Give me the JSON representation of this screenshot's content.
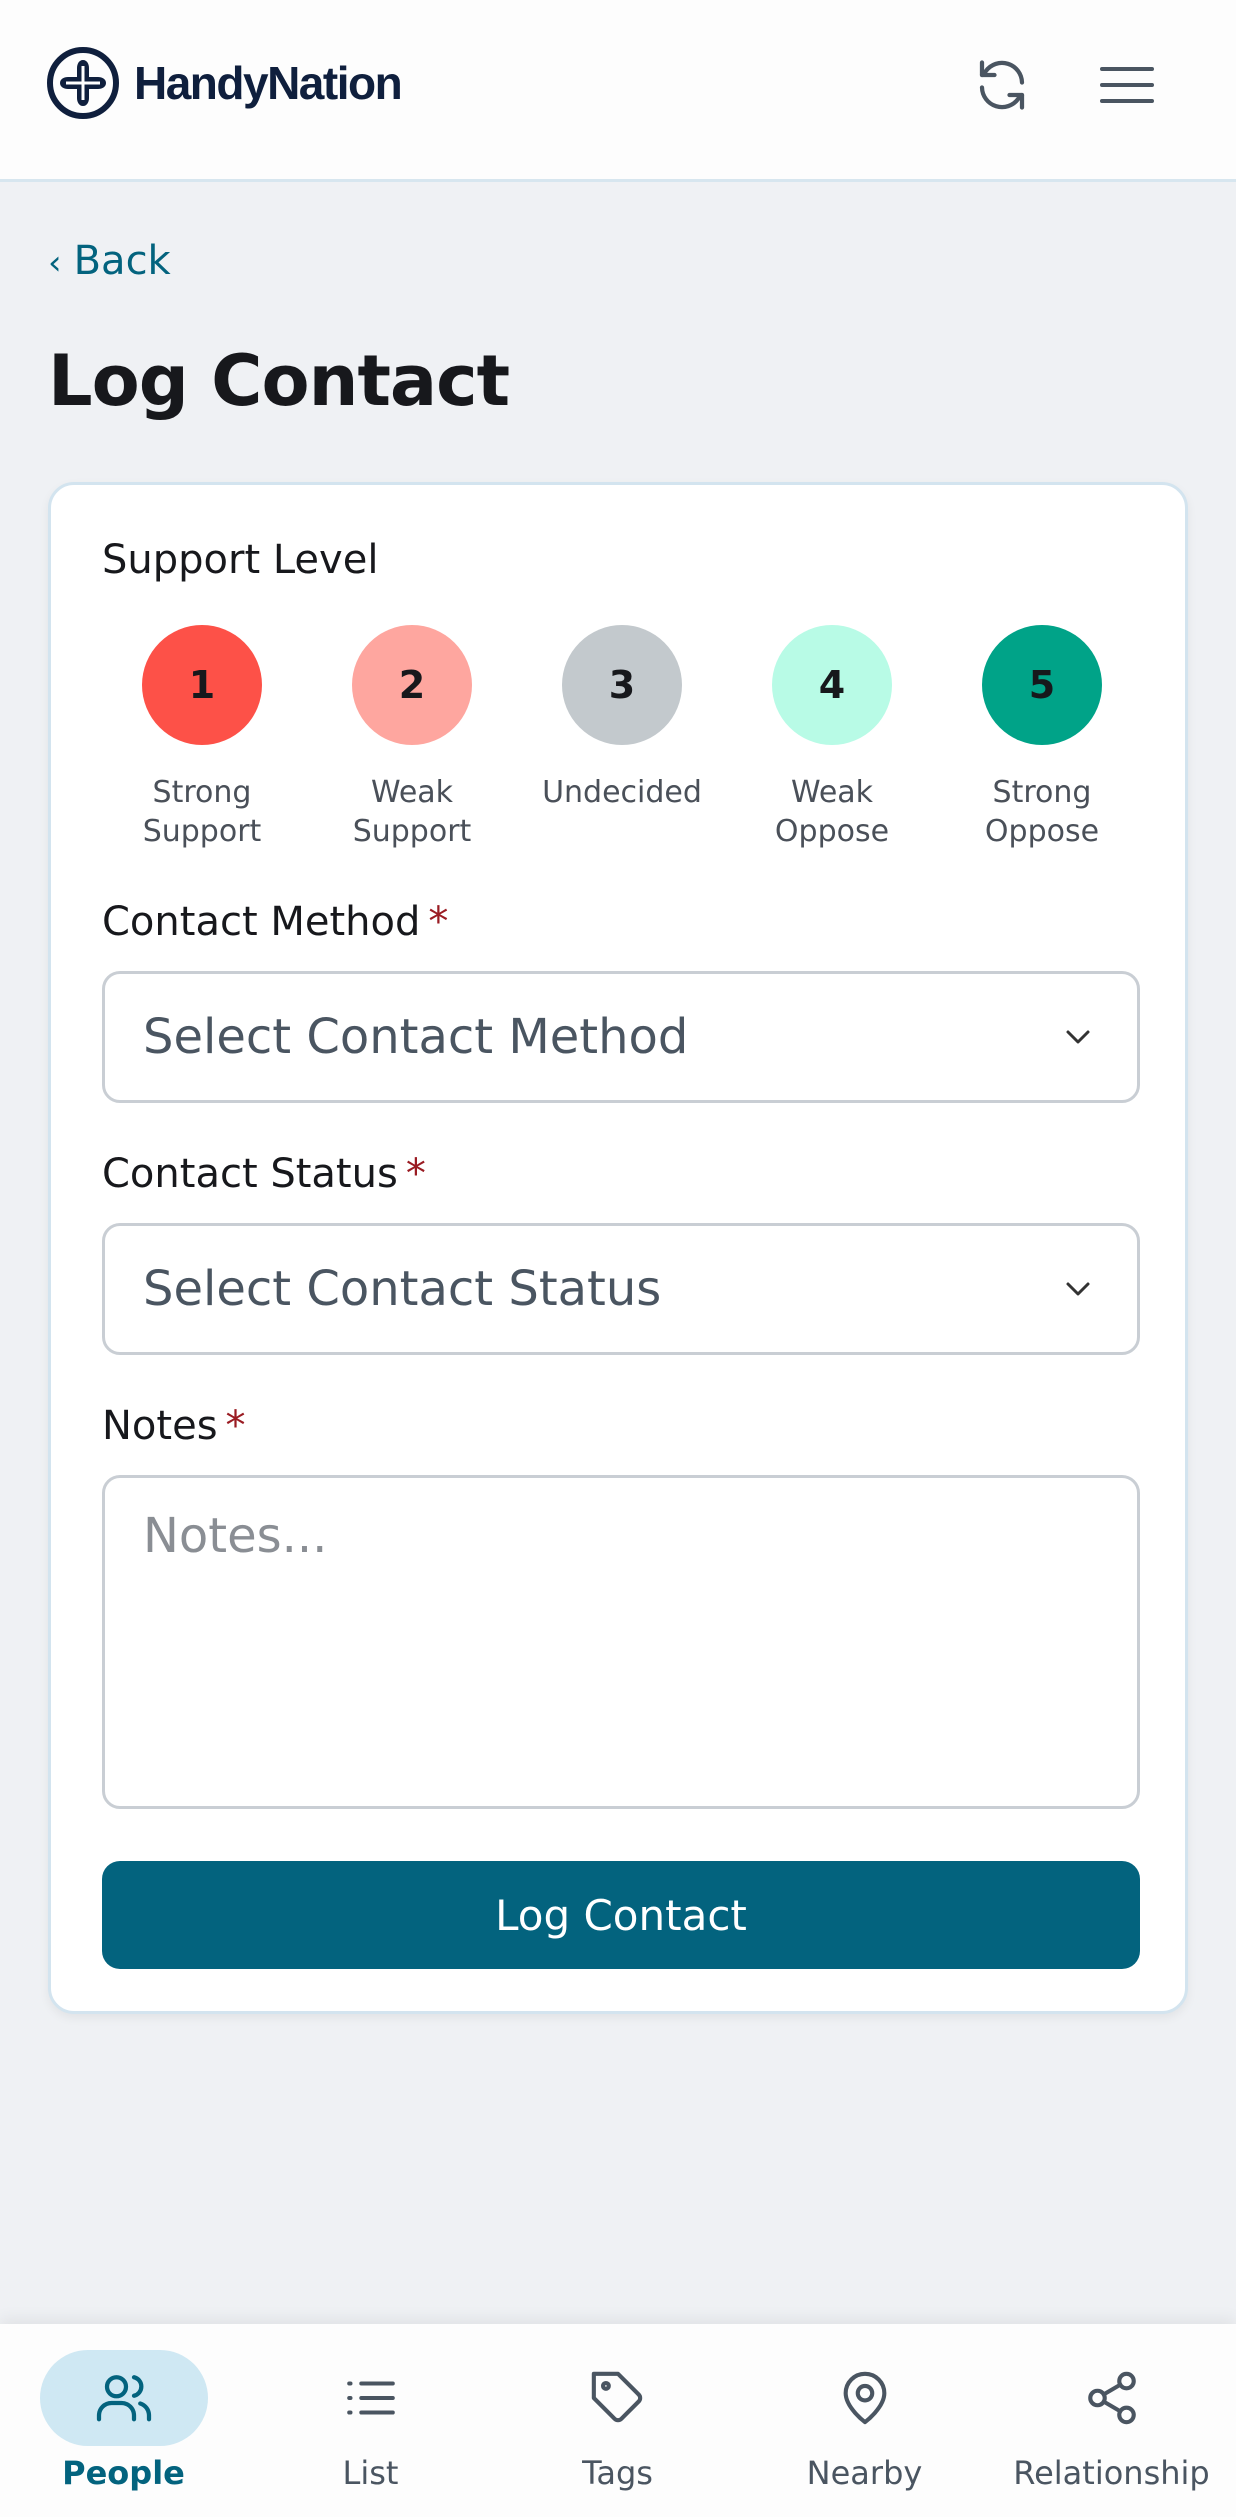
{
  "header": {
    "brand": "HandyNation",
    "icons": {
      "logo": "plus-cross-logo-icon",
      "refresh": "refresh-icon",
      "menu": "hamburger-menu-icon"
    }
  },
  "nav": {
    "back_label": "Back"
  },
  "page": {
    "title": "Log Contact"
  },
  "form": {
    "support_level": {
      "label": "Support Level",
      "levels": [
        {
          "number": "1",
          "line1": "Strong",
          "line2": "Support",
          "color": "#fd5148"
        },
        {
          "number": "2",
          "line1": "Weak",
          "line2": "Support",
          "color": "#fea69f"
        },
        {
          "number": "3",
          "line1": "Undecided",
          "line2": "",
          "color": "#c3c9cd"
        },
        {
          "number": "4",
          "line1": "Weak",
          "line2": "Oppose",
          "color": "#b8fbe6"
        },
        {
          "number": "5",
          "line1": "Strong",
          "line2": "Oppose",
          "color": "#00a388"
        }
      ]
    },
    "contact_method": {
      "label": "Contact Method",
      "required_mark": "*",
      "value": "Select Contact Method"
    },
    "contact_status": {
      "label": "Contact Status",
      "required_mark": "*",
      "value": "Select Contact Status"
    },
    "notes": {
      "label": "Notes",
      "required_mark": "*",
      "placeholder": "Notes..."
    },
    "submit_label": "Log Contact"
  },
  "bottom_nav": {
    "active": "People",
    "items": [
      {
        "label": "People",
        "icon": "people-icon"
      },
      {
        "label": "List",
        "icon": "list-icon"
      },
      {
        "label": "Tags",
        "icon": "tag-icon"
      },
      {
        "label": "Nearby",
        "icon": "map-pin-icon"
      },
      {
        "label": "Relationship",
        "icon": "share-nodes-icon"
      }
    ]
  },
  "colors": {
    "accent": "#03637e",
    "required": "#9a1b22",
    "active_nav_bg": "#cfe8f3"
  }
}
